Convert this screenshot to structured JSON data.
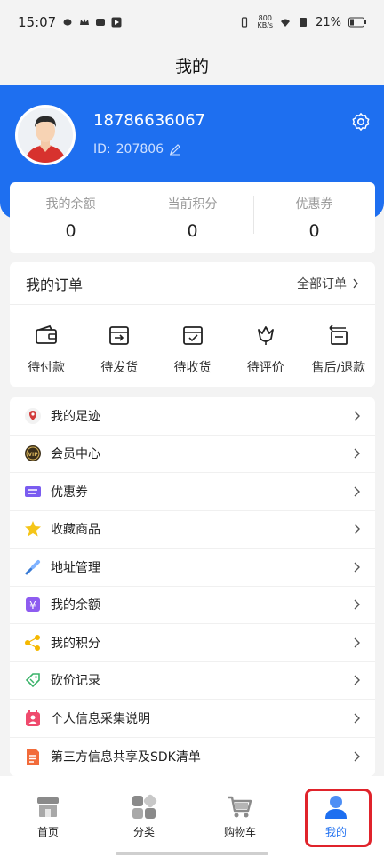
{
  "status": {
    "time": "15:07",
    "net_speed_top": "800",
    "net_speed_bottom": "KB/s",
    "battery": "21%"
  },
  "title": "我的",
  "profile": {
    "phone": "18786636067",
    "id_label": "ID:",
    "id_value": "207806"
  },
  "stats": [
    {
      "label": "我的余额",
      "value": "0"
    },
    {
      "label": "当前积分",
      "value": "0"
    },
    {
      "label": "优惠券",
      "value": "0"
    }
  ],
  "orders": {
    "title": "我的订单",
    "all_label": "全部订单",
    "items": [
      {
        "label": "待付款",
        "icon": "wallet-icon"
      },
      {
        "label": "待发货",
        "icon": "ship-icon"
      },
      {
        "label": "待收货",
        "icon": "receive-icon"
      },
      {
        "label": "待评价",
        "icon": "review-icon"
      },
      {
        "label": "售后/退款",
        "icon": "refund-icon"
      }
    ]
  },
  "menu": [
    {
      "label": "我的足迹",
      "icon": "location-icon"
    },
    {
      "label": "会员中心",
      "icon": "vip-icon"
    },
    {
      "label": "优惠券",
      "icon": "coupon-icon"
    },
    {
      "label": "收藏商品",
      "icon": "star-icon"
    },
    {
      "label": "地址管理",
      "icon": "address-icon"
    },
    {
      "label": "我的余额",
      "icon": "balance-icon"
    },
    {
      "label": "我的积分",
      "icon": "points-icon"
    },
    {
      "label": "砍价记录",
      "icon": "bargain-icon"
    },
    {
      "label": "个人信息采集说明",
      "icon": "personal-info-icon"
    },
    {
      "label": "第三方信息共享及SDK清单",
      "icon": "document-icon"
    }
  ],
  "nav": [
    {
      "label": "首页",
      "icon": "home-icon"
    },
    {
      "label": "分类",
      "icon": "category-icon"
    },
    {
      "label": "购物车",
      "icon": "cart-icon"
    },
    {
      "label": "我的",
      "icon": "user-icon"
    }
  ],
  "colors": {
    "brand": "#1e6ff0",
    "highlight": "#e0232b"
  }
}
